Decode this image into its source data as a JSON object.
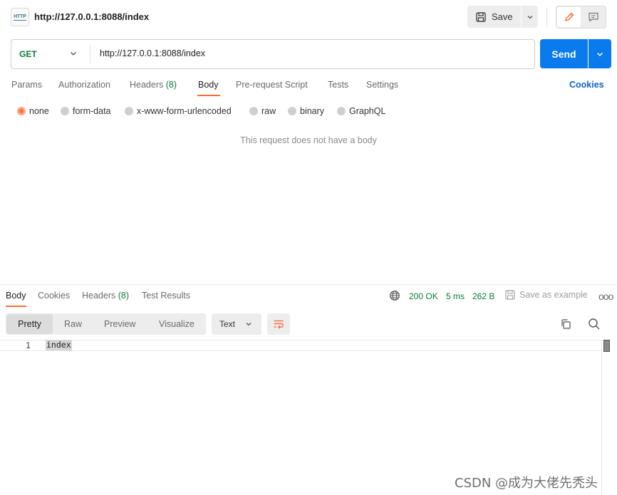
{
  "request": {
    "title": "http://127.0.0.1:8088/index",
    "icon_text": "HTTP",
    "save_label": "Save",
    "method": "GET",
    "url": "http://127.0.0.1:8088/index",
    "send_label": "Send",
    "tabs": [
      {
        "label": "Params"
      },
      {
        "label": "Authorization"
      },
      {
        "label": "Headers",
        "count": "(8)"
      },
      {
        "label": "Body",
        "active": true
      },
      {
        "label": "Pre-request Script"
      },
      {
        "label": "Tests"
      },
      {
        "label": "Settings"
      }
    ],
    "cookies_label": "Cookies",
    "body_types": [
      {
        "label": "none",
        "selected": true
      },
      {
        "label": "form-data"
      },
      {
        "label": "x-www-form-urlencoded"
      },
      {
        "label": "raw"
      },
      {
        "label": "binary"
      },
      {
        "label": "GraphQL"
      }
    ],
    "empty_body_message": "This request does not have a body"
  },
  "response": {
    "tabs": [
      {
        "label": "Body",
        "active": true
      },
      {
        "label": "Cookies"
      },
      {
        "label": "Headers",
        "count": "(8)"
      },
      {
        "label": "Test Results"
      }
    ],
    "status": "200 OK",
    "time": "5 ms",
    "size": "262 B",
    "save_example_label": "Save as example",
    "more_label": "ooo",
    "views": [
      "Pretty",
      "Raw",
      "Preview",
      "Visualize"
    ],
    "format": "Text",
    "lines": [
      {
        "number": "1",
        "text": "index"
      }
    ]
  },
  "watermark": "CSDN @成为大佬先秃头",
  "colors": {
    "accent": "#ff6c37",
    "send": "#097bed",
    "success": "#0b7a3e",
    "link": "#0c65c4"
  },
  "icons": [
    "http-icon",
    "floppy-disk-icon",
    "chevron-down-icon",
    "pencil-icon",
    "comment-icon",
    "globe-icon",
    "wrap-lines-icon",
    "copy-icon",
    "search-icon"
  ]
}
